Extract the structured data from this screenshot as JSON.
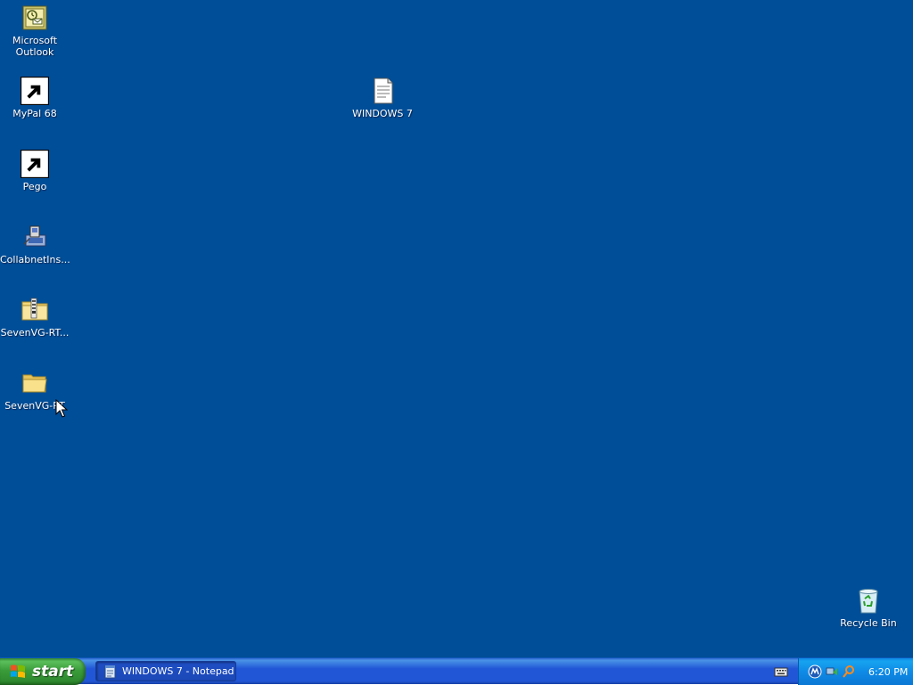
{
  "desktop": {
    "background": "#004e98",
    "icons": [
      {
        "label": "Microsoft\nOutlook",
        "icon": "outlook-icon"
      },
      {
        "label": "MyPal 68",
        "icon": "mypal-icon"
      },
      {
        "label": "Pego",
        "icon": "pego-icon"
      },
      {
        "label": "CollabnetIns...",
        "icon": "installer-icon"
      },
      {
        "label": "SevenVG-RT...",
        "icon": "zip-folder-icon"
      },
      {
        "label": "SevenVG-RT",
        "icon": "folder-icon"
      },
      {
        "label": "WINDOWS 7",
        "icon": "text-document-icon"
      },
      {
        "label": "Recycle Bin",
        "icon": "recycle-bin-icon"
      }
    ]
  },
  "taskbar": {
    "start_label": "start",
    "tasks": [
      {
        "label": "WINDOWS 7 - Notepad",
        "icon": "notepad-icon"
      }
    ],
    "tray": {
      "icons": [
        "language-bar-icon",
        "malwarebytes-icon",
        "network-icon",
        "search-icon"
      ],
      "clock": "6:20 PM"
    }
  }
}
